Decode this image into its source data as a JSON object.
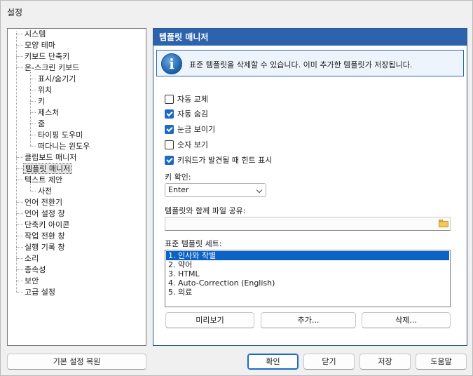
{
  "window": {
    "title": "설정"
  },
  "tree": {
    "items": [
      {
        "label": "시스템"
      },
      {
        "label": "모양 테마"
      },
      {
        "label": "키보드 단축키"
      },
      {
        "label": "온-스크린 키보드"
      },
      {
        "label": "표시/숨기기"
      },
      {
        "label": "위치"
      },
      {
        "label": "키"
      },
      {
        "label": "제스처"
      },
      {
        "label": "줌"
      },
      {
        "label": "타이핑 도우미"
      },
      {
        "label": "떠다니는 윈도우"
      },
      {
        "label": "클립보드 매니저"
      },
      {
        "label": "템플릿 매니저"
      },
      {
        "label": "텍스트 제안"
      },
      {
        "label": "사전"
      },
      {
        "label": "언어 전환기"
      },
      {
        "label": "언어 설정 창"
      },
      {
        "label": "단축키 아이콘"
      },
      {
        "label": "작업 전환 창"
      },
      {
        "label": "실행 기록 창"
      },
      {
        "label": "소리"
      },
      {
        "label": "종속성"
      },
      {
        "label": "보안"
      },
      {
        "label": "고급 설정"
      }
    ],
    "selected": "템플릿 매니저"
  },
  "panel": {
    "header": "템플릿 매니저",
    "info": "표준 템플릿을 삭제할 수 있습니다. 이미 추가한 템플릿가 저장됩니다.",
    "checkboxes": [
      {
        "label": "자동 교체",
        "checked": false
      },
      {
        "label": "자동 숨김",
        "checked": true
      },
      {
        "label": "눈금 보이기",
        "checked": true
      },
      {
        "label": "숫자 보기",
        "checked": false
      },
      {
        "label": "키워드가 발견될 때 힌트 표시",
        "checked": true
      }
    ],
    "key_confirm_label": "키 확인:",
    "key_confirm_value": "Enter",
    "share_label": "템플릿와 함께 파일 공유:",
    "share_value": "",
    "template_sets_label": "표준 템플릿 세트:",
    "template_sets": [
      "1. 인사와 작별",
      "2. 약어",
      "3. HTML",
      "4. Auto-Correction (English)",
      "5. 의료"
    ],
    "preview_button": "미리보기",
    "add_button": "추가...",
    "delete_button": "삭제..."
  },
  "footer": {
    "reset_button": "기본 설정 복원",
    "ok_button": "확인",
    "close_button": "닫기",
    "save_button": "저장",
    "help_button": "도움말"
  },
  "colors": {
    "accent": "#2d63ad",
    "selection": "#0a64c8",
    "checkbox": "#1c6ac4"
  },
  "icons": {
    "info": "info-icon",
    "folder": "folder-icon"
  }
}
